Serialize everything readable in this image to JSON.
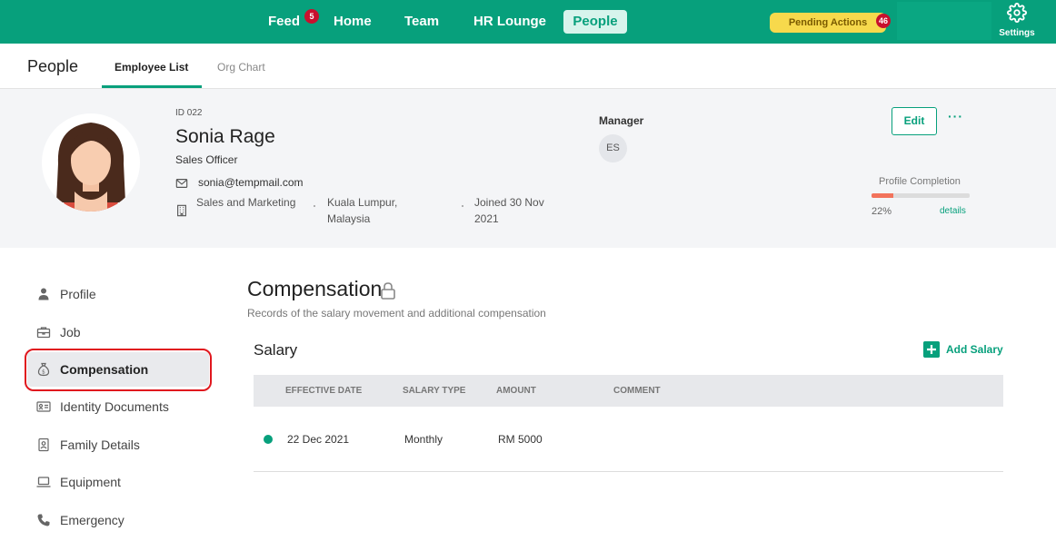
{
  "nav": {
    "items": [
      {
        "label": "Feed",
        "badge": "5"
      },
      {
        "label": "Home"
      },
      {
        "label": "Team"
      },
      {
        "label": "HR Lounge"
      },
      {
        "label": "People",
        "active": true
      }
    ],
    "pending_label": "Pending Actions",
    "pending_count": "46",
    "settings_label": "Settings",
    "accent": "#07a07c"
  },
  "subheader": {
    "title": "People",
    "tabs": [
      {
        "label": "Employee List",
        "active": true
      },
      {
        "label": "Org Chart"
      }
    ]
  },
  "employee": {
    "id": "ID 022",
    "name": "Sonia Rage",
    "title": "Sales Officer",
    "email": "sonia@tempmail.com",
    "department": "Sales and Marketing",
    "location": "Kuala Lumpur, Malaysia",
    "joined": "Joined 30 Nov 2021",
    "manager_label": "Manager",
    "manager_initials": "ES",
    "edit_label": "Edit",
    "more_label": "···",
    "profile_completion_label": "Profile Completion",
    "profile_completion_pct": "22%",
    "profile_completion_value": 22,
    "details_label": "details"
  },
  "sidebar": {
    "items": [
      {
        "label": "Profile",
        "icon": "person-icon"
      },
      {
        "label": "Job",
        "icon": "briefcase-icon"
      },
      {
        "label": "Compensation",
        "icon": "money-bag-icon",
        "active": true
      },
      {
        "label": "Identity Documents",
        "icon": "id-card-icon"
      },
      {
        "label": "Family Details",
        "icon": "contact-book-icon"
      },
      {
        "label": "Equipment",
        "icon": "laptop-icon"
      },
      {
        "label": "Emergency",
        "icon": "phone-icon"
      }
    ]
  },
  "compensation": {
    "title": "Compensation",
    "subtitle": "Records of the salary movement and additional compensation",
    "salary_title": "Salary",
    "add_salary_label": "Add Salary",
    "columns": [
      "EFFECTIVE DATE",
      "SALARY TYPE",
      "AMOUNT",
      "COMMENT"
    ],
    "rows": [
      {
        "effective_date": "22 Dec 2021",
        "salary_type": "Monthly",
        "amount": "RM 5000",
        "comment": ""
      }
    ]
  }
}
